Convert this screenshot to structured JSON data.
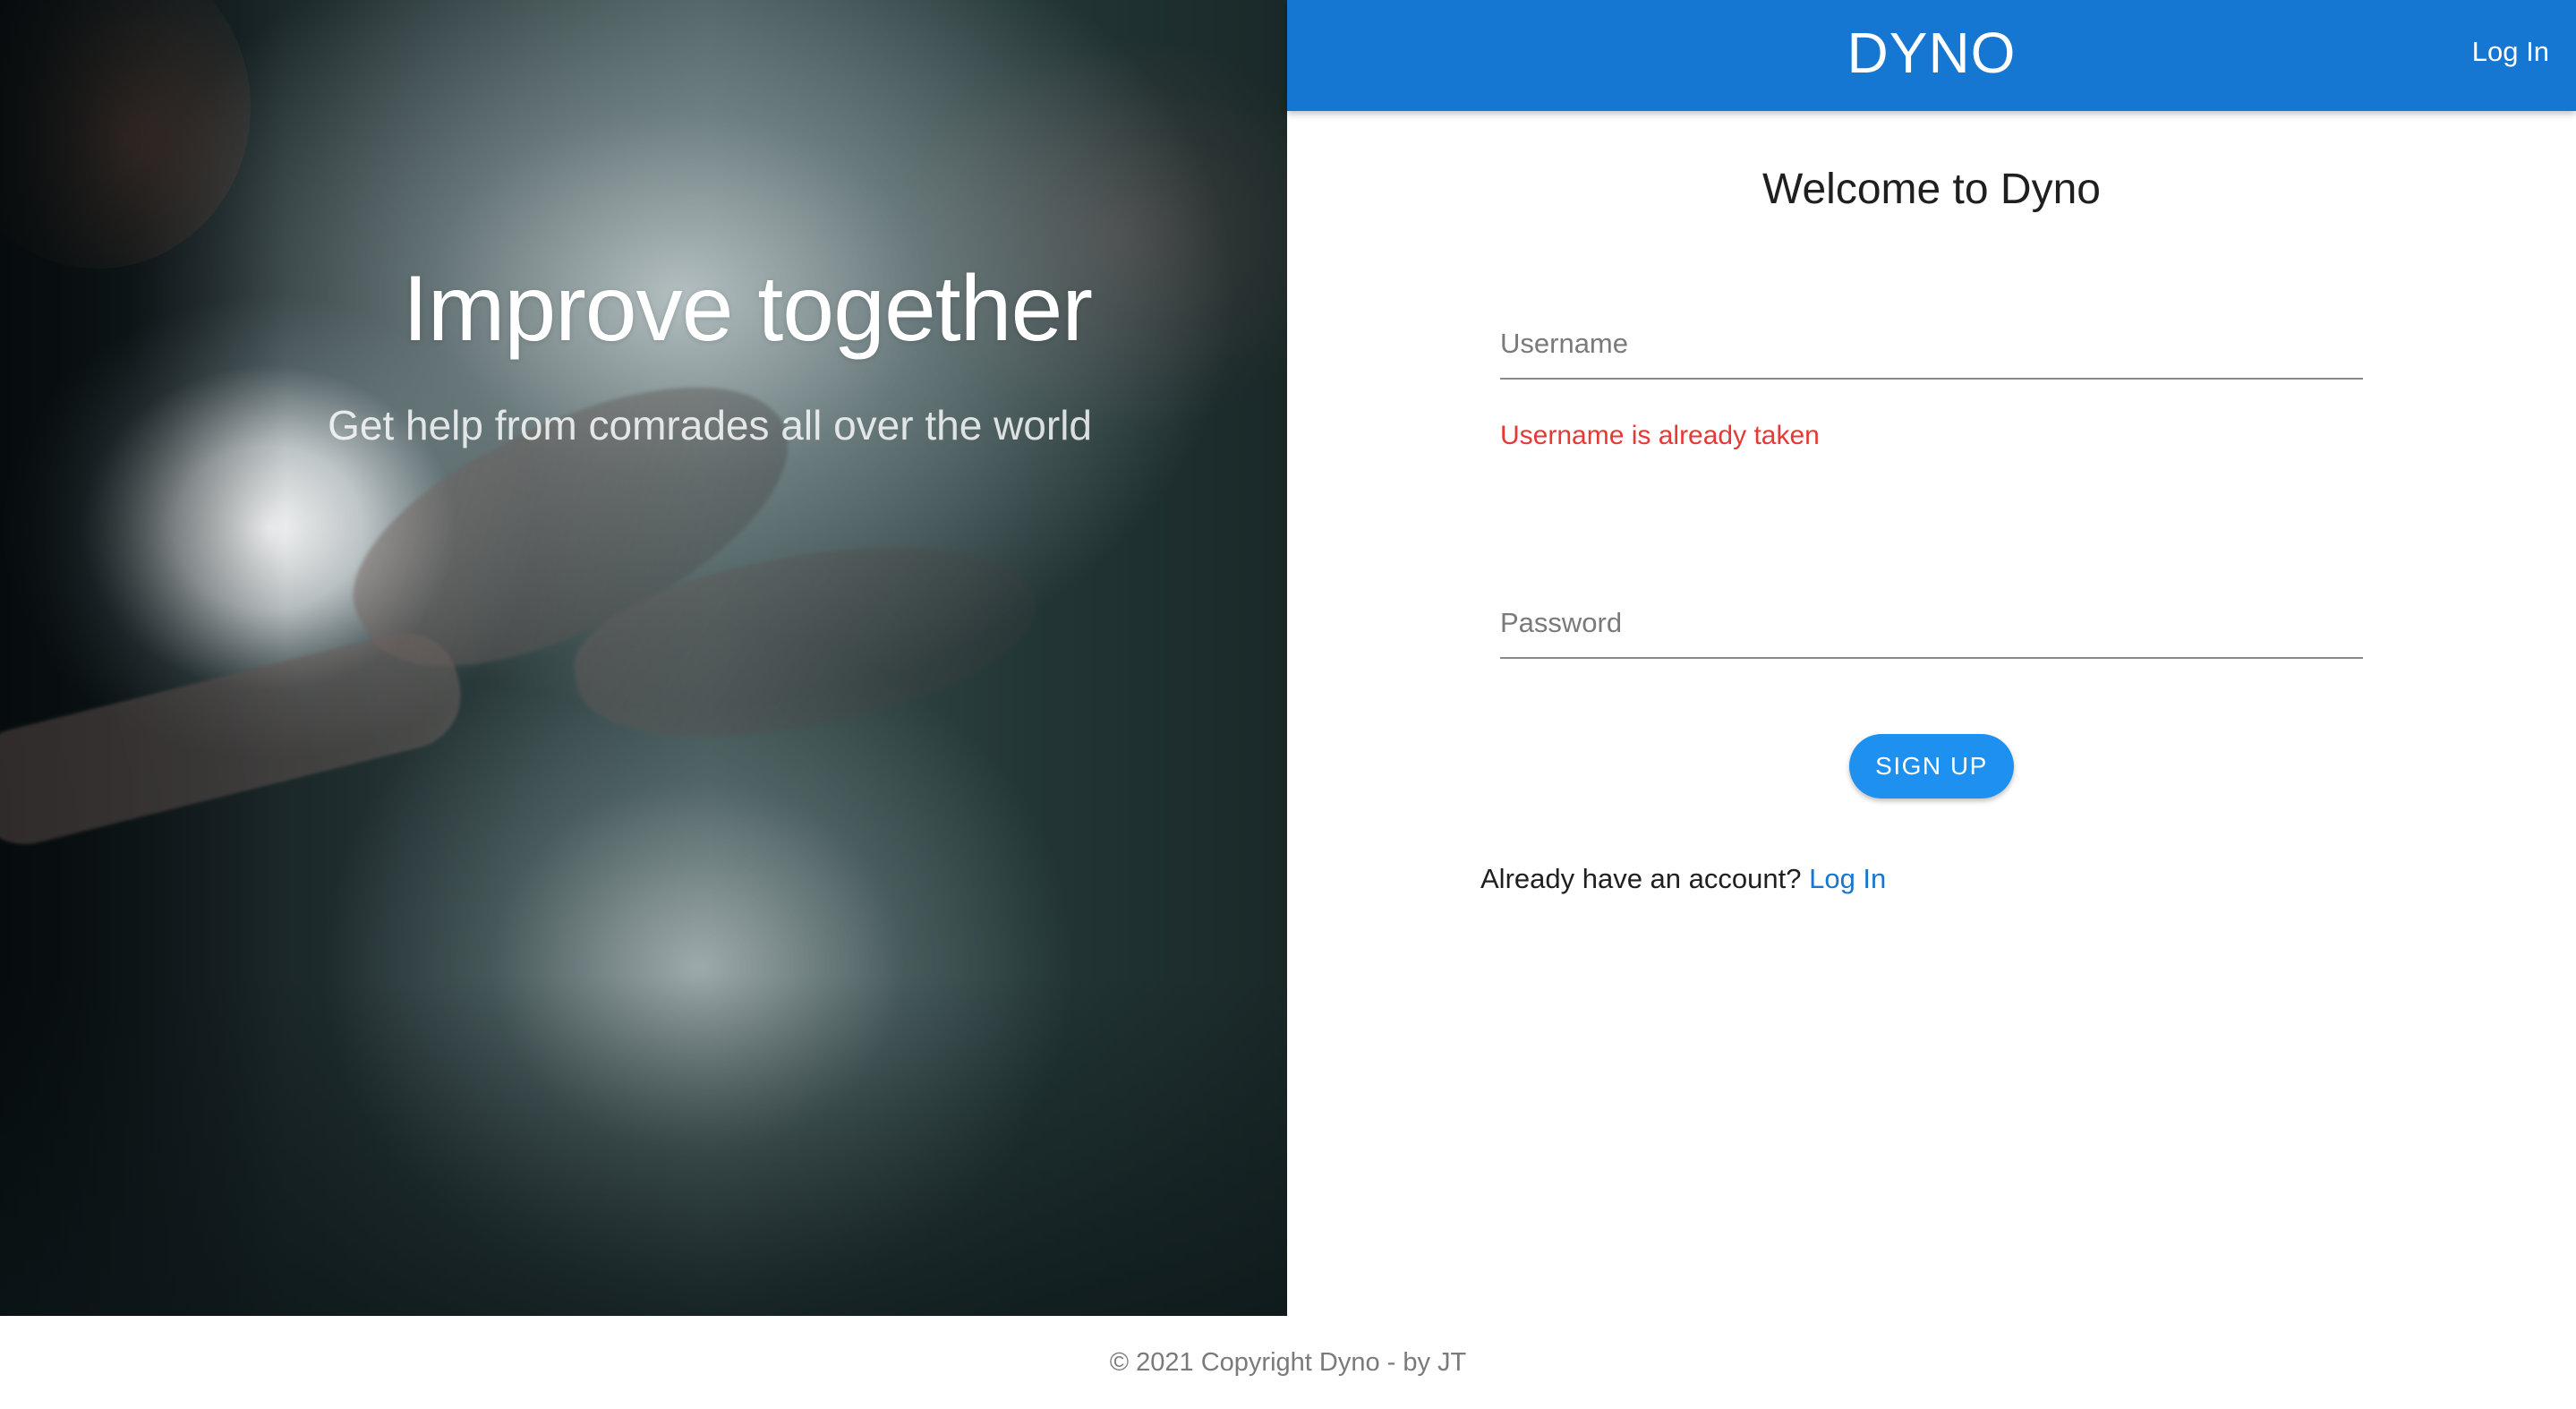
{
  "hero": {
    "title": "Improve together",
    "subtitle": "Get help from comrades all over the world"
  },
  "header": {
    "brand": "DYNO",
    "login_link": "Log In",
    "background_color": "#1677d2"
  },
  "form": {
    "heading": "Welcome to Dyno",
    "username": {
      "placeholder": "Username",
      "value": "",
      "error": "Username is already taken"
    },
    "password": {
      "placeholder": "Password",
      "value": ""
    },
    "submit_label": "SIGN UP",
    "account_prompt": "Already have an account?",
    "account_link": "Log In",
    "error_color": "#e53935",
    "link_color": "#1677d2"
  },
  "footer": {
    "text": "© 2021 Copyright Dyno - by JT"
  }
}
